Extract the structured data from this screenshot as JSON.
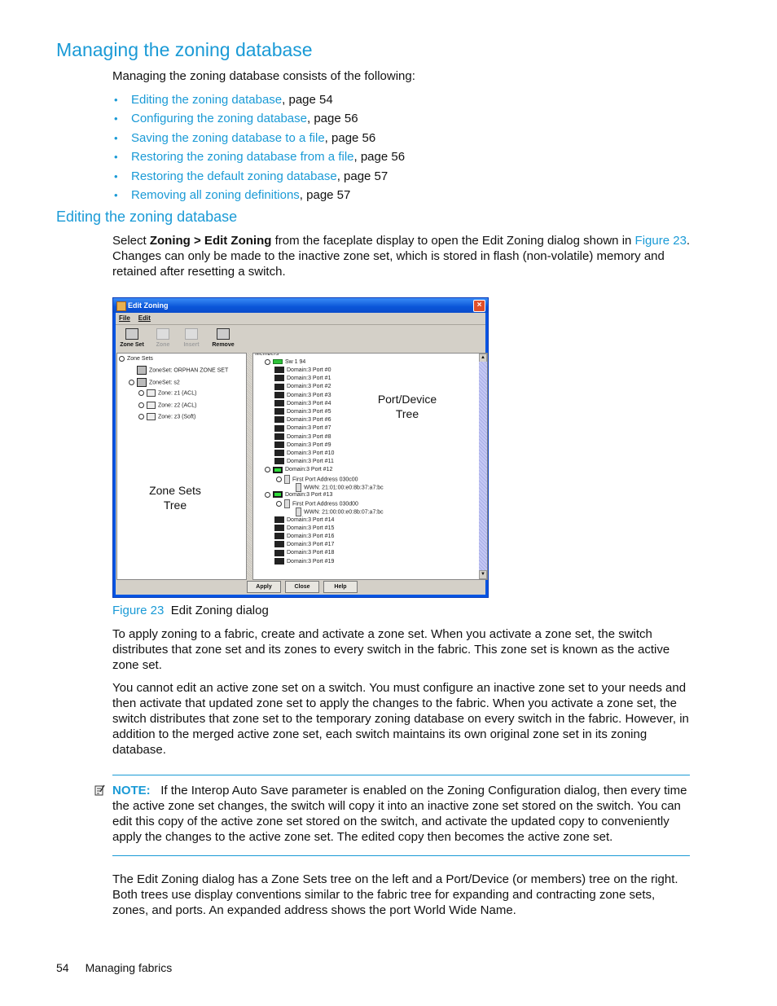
{
  "heading1": "Managing the zoning database",
  "intro": "Managing the zoning database consists of the following:",
  "toc_items": [
    {
      "link": "Editing the zoning database",
      "suffix": ", page 54"
    },
    {
      "link": "Configuring the zoning database",
      "suffix": ", page 56"
    },
    {
      "link": "Saving the zoning database to a file",
      "suffix": ", page 56"
    },
    {
      "link": "Restoring the zoning database from a file",
      "suffix": ", page 56"
    },
    {
      "link": "Restoring the default zoning database",
      "suffix": ", page 57"
    },
    {
      "link": "Removing all zoning definitions",
      "suffix": ", page 57"
    }
  ],
  "heading2": "Editing the zoning database",
  "para1": {
    "pre": "Select ",
    "bold": "Zoning > Edit Zoning",
    "mid": " from the faceplate display to open the Edit Zoning dialog shown in ",
    "link": "Figure 23",
    "post": ". Changes can only be made to the inactive zone set, which is stored in flash (non-volatile) memory and retained after resetting a switch."
  },
  "dialog": {
    "title": "Edit Zoning",
    "menu": [
      "File",
      "Edit"
    ],
    "toolbar": [
      {
        "label": "Zone Set",
        "enabled": true
      },
      {
        "label": "Zone",
        "enabled": false
      },
      {
        "label": "Insert",
        "enabled": false
      },
      {
        "label": "Remove",
        "enabled": true
      }
    ],
    "zone_tree": {
      "root": "Zone Sets",
      "items": [
        {
          "label": "ZoneSet: ORPHAN ZONE SET",
          "type": "zoneset",
          "level": 1
        },
        {
          "label": "ZoneSet: s2",
          "type": "zoneset",
          "level": 1
        },
        {
          "label": "Zone: z1 (ACL)",
          "type": "zone",
          "level": 2
        },
        {
          "label": "Zone: z2 (ACL)",
          "type": "zone",
          "level": 2
        },
        {
          "label": "Zone: z3 (Soft)",
          "type": "zone",
          "level": 2
        }
      ]
    },
    "members_tree": {
      "header": "Members",
      "switch": "Sw 1 94",
      "items": [
        {
          "label": "Domain:3 Port #0",
          "type": "port"
        },
        {
          "label": "Domain:3 Port #1",
          "type": "port"
        },
        {
          "label": "Domain:3 Port #2",
          "type": "port"
        },
        {
          "label": "Domain:3 Port #3",
          "type": "port"
        },
        {
          "label": "Domain:3 Port #4",
          "type": "port"
        },
        {
          "label": "Domain:3 Port #5",
          "type": "port"
        },
        {
          "label": "Domain:3 Port #6",
          "type": "port"
        },
        {
          "label": "Domain:3 Port #7",
          "type": "port"
        },
        {
          "label": "Domain:3 Port #8",
          "type": "port"
        },
        {
          "label": "Domain:3 Port #9",
          "type": "port"
        },
        {
          "label": "Domain:3 Port #10",
          "type": "port"
        },
        {
          "label": "Domain:3 Port #11",
          "type": "port"
        },
        {
          "label": "Domain:3 Port #12",
          "type": "port-active"
        },
        {
          "label": "First Port Address 030c00",
          "type": "device"
        },
        {
          "label": "WWN: 21:01:00:e0:8b:37:a7:bc",
          "type": "wwn"
        },
        {
          "label": "Domain:3 Port #13",
          "type": "port-active"
        },
        {
          "label": "First Port Address 030d00",
          "type": "device"
        },
        {
          "label": "WWN: 21:00:00:e0:8b:07:a7:bc",
          "type": "wwn"
        },
        {
          "label": "Domain:3 Port #14",
          "type": "port"
        },
        {
          "label": "Domain:3 Port #15",
          "type": "port"
        },
        {
          "label": "Domain:3 Port #16",
          "type": "port"
        },
        {
          "label": "Domain:3 Port #17",
          "type": "port"
        },
        {
          "label": "Domain:3 Port #18",
          "type": "port"
        },
        {
          "label": "Domain:3 Port #19",
          "type": "port"
        }
      ]
    },
    "buttons": [
      "Apply",
      "Close",
      "Help"
    ],
    "callout_zone": "Zone Sets\nTree",
    "callout_zone_l1": "Zone Sets",
    "callout_zone_l2": "Tree",
    "callout_port_l1": "Port/Device",
    "callout_port_l2": "Tree"
  },
  "caption": {
    "fig": "Figure 23",
    "text": "Edit Zoning dialog"
  },
  "para2": "To apply zoning to a fabric, create and activate a zone set. When you activate a zone set, the switch distributes that zone set and its zones to every switch in the fabric. This zone set is known as the active zone set.",
  "para3": "You cannot edit an active zone set on a switch. You must configure an inactive zone set to your needs and then activate that updated zone set to apply the changes to the fabric. When you activate a zone set, the switch distributes that zone set to the temporary zoning database on every switch in the fabric. However, in addition to the merged active zone set, each switch maintains its own original zone set in its zoning database.",
  "note": {
    "label": "NOTE:",
    "text": "If the Interop Auto Save parameter is enabled on the Zoning Configuration dialog, then every time the active zone set changes, the switch will copy it into an inactive zone set stored on the switch. You can edit this copy of the active zone set stored on the switch, and activate the updated copy to conveniently apply the changes to the active zone set. The edited copy then becomes the active zone set."
  },
  "para4": "The Edit Zoning dialog has a Zone Sets tree on the left and a Port/Device (or members) tree on the right. Both trees use display conventions similar to the fabric tree for expanding and contracting zone sets, zones, and ports. An expanded address shows the port World Wide Name.",
  "footer": {
    "page": "54",
    "section": "Managing fabrics"
  },
  "colors": {
    "accent": "#1a9ad6",
    "dialog_frame": "#0054e3"
  }
}
